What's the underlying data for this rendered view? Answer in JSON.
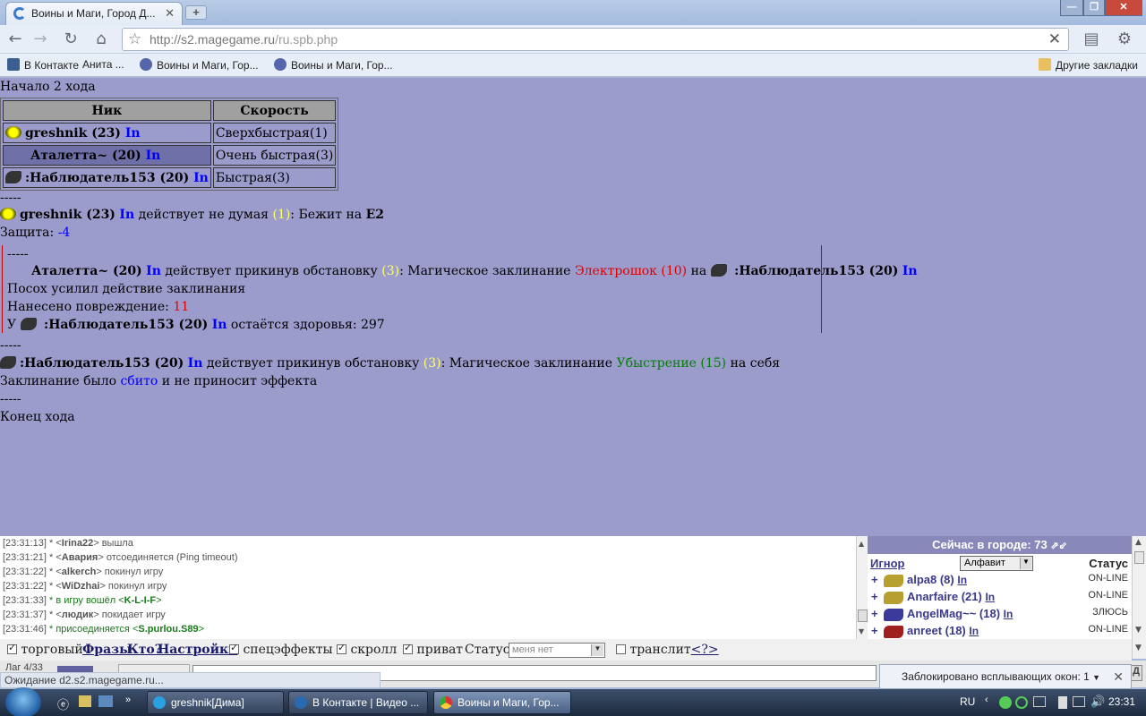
{
  "browser": {
    "tab_title": "Воины и Маги, Город Д...",
    "url_host": "http://s2.magegame.ru",
    "url_path": "/ru.spb.php",
    "bookmarks": [
      "В Контакте",
      "Анита ...",
      "Воины и Маги, Гор...",
      "Воины и Маги, Гор..."
    ],
    "bookmarks_other": "Другие закладки"
  },
  "game": {
    "turn_start": "Начало 2 хода",
    "table_headers": [
      "Ник",
      "Скорость"
    ],
    "players": [
      {
        "nick": "greshnik (23)",
        "in": "In",
        "speed": "Сверхбыстрая(1)"
      },
      {
        "nick": "Аталетта~ (20)",
        "in": "In",
        "speed": "Очень быстрая(3)"
      },
      {
        "nick": ":Наблюдатель153 (20)",
        "in": "In",
        "speed": "Быстрая(3)"
      }
    ],
    "sep": "-----",
    "log1": {
      "name": "greshnik (23)",
      "in": "In",
      "act": "действует не думая",
      "num": "(1)",
      "rest": ": Бежит на",
      "target": "E2"
    },
    "def_label": "Защита:",
    "def_value": "-4",
    "spell_block": {
      "sep": "-----",
      "name": "Аталетта~ (20)",
      "in": "In",
      "act": "действует прикинув обстановку",
      "num": "(3)",
      "spell_prefix": ": Магическое заклинание",
      "spell": "Электрошок (10)",
      "on": "на",
      "target": ":Наблюдатель153 (20)",
      "target_in": "In",
      "line2": "Посох усилил действие заклинания",
      "dmg_label": "Нанесено повреждение:",
      "dmg": "11",
      "hp_prefix": "У",
      "hp_name": ":Наблюдатель153 (20)",
      "hp_in": "In",
      "hp_rest": "остаётся здоровья: 297"
    },
    "log3": {
      "name": ":Наблюдатель153 (20)",
      "in": "In",
      "act": "действует прикинув обстановку",
      "num": "(3)",
      "spell_prefix": ": Магическое заклинание",
      "spell": "Убыстрение (15)",
      "rest": "на себя"
    },
    "cancel_a": "Заклинание было",
    "cancel_b": "сбито",
    "cancel_c": "и не приносит эффекта",
    "turn_end": "Конец хода"
  },
  "chat": [
    {
      "time": "[23:31:13]",
      "a": "* <",
      "name": "Irina22",
      "b": "> вышла"
    },
    {
      "time": "[23:31:21]",
      "a": "* <",
      "name": "Авария",
      "b": "> отсоединяется (Ping timeout)"
    },
    {
      "time": "[23:31:22]",
      "a": "* <",
      "name": "alkerch",
      "b": "> покинул игру"
    },
    {
      "time": "[23:31:22]",
      "a": "* <",
      "name": "WiDzhai",
      "b": "> покинул игру"
    },
    {
      "time": "[23:31:33]",
      "a": "* в игру вошёл <",
      "name": "K-L-I-F",
      "b": ">"
    },
    {
      "time": "[23:31:37]",
      "a": "* <",
      "name": "людик",
      "b": "> покидает игру"
    },
    {
      "time": "[23:31:46]",
      "a": "* присоединяется <",
      "name": "S.purlou.S89",
      "b": ">"
    }
  ],
  "online": {
    "title": "Сейчас в городе: 73",
    "ignore": "Игнор",
    "sort": "Алфавит",
    "status": "Статус",
    "users": [
      {
        "name": "alpa8 (8)",
        "in": "In",
        "status": "ON-LINE"
      },
      {
        "name": "Anarfaire (21)",
        "in": "In",
        "status": "ON-LINE"
      },
      {
        "name": "AngelMag~~ (18)",
        "in": "In",
        "status": "ЗЛЮСЬ"
      },
      {
        "name": "anreet (18)",
        "in": "In",
        "status": "ON-LINE"
      }
    ]
  },
  "controls": {
    "trade": "торговый",
    "phrases": "Фразы",
    "who": "Кто?",
    "settings": "Настройки",
    "effects": "спецэффекты",
    "scroll": "скролл",
    "private": "приват",
    "status_label": "Статус:",
    "status_value": "меня нет",
    "translit": "транслит",
    "help": "<?>",
    "lag": "Лаг 4/33"
  },
  "statusbar": "Ожидание d2.s2.magegame.ru...",
  "popup": "Заблокировано всплывающих окон: 1",
  "taskbar": {
    "tasks": [
      "greshnik[Дима]",
      "В Контакте | Видео ...",
      "Воины и Маги, Гор..."
    ],
    "lang": "RU",
    "time": "23:31"
  }
}
